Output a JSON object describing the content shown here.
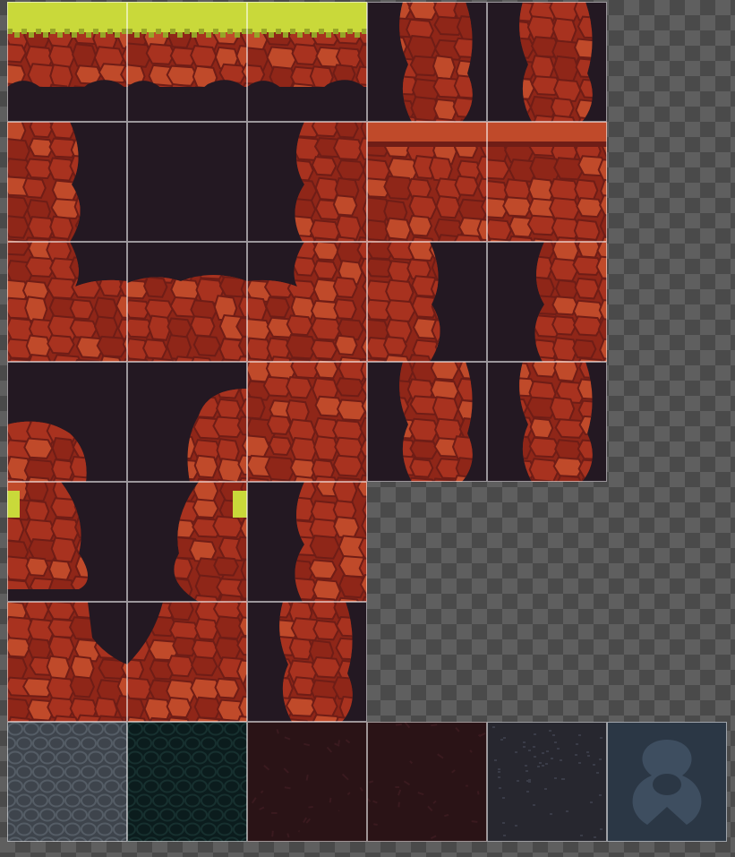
{
  "tileset": {
    "colors": {
      "dark": "#231822",
      "rock": "#8f2618",
      "rockMid": "#a8321f",
      "rockLight": "#c04a2a",
      "rockShadow": "#6f1d16",
      "moss": "#c9d93a",
      "mossDark": "#97a528",
      "slate": "#3e444c",
      "slateLight": "#555d66",
      "teal": "#0b1c1d",
      "tealLight": "#17302f",
      "wine": "#2a1316",
      "wineLight": "#3a1a1f",
      "navy": "#27272f",
      "navyLight": "#3a3c48",
      "steel": "#2b3745",
      "steelLight": "#3e4e60"
    },
    "tiles": [
      {
        "id": "r0c0",
        "name": "tile-ground-grass-top-left",
        "kind": "grass-top"
      },
      {
        "id": "r0c1",
        "name": "tile-ground-grass-top-mid",
        "kind": "grass-top"
      },
      {
        "id": "r0c2",
        "name": "tile-ground-grass-top-right",
        "kind": "grass-top"
      },
      {
        "id": "r0c3",
        "name": "tile-rock-pillar-dark-left",
        "kind": "pillar"
      },
      {
        "id": "r0c4",
        "name": "tile-rock-pillar-dark-right",
        "kind": "pillar"
      },
      {
        "id": "r1c0",
        "name": "tile-cave-wall-left",
        "kind": "wall-left"
      },
      {
        "id": "r1c1",
        "name": "tile-cave-interior",
        "kind": "dark"
      },
      {
        "id": "r1c2",
        "name": "tile-cave-wall-right",
        "kind": "wall-right"
      },
      {
        "id": "r1c3",
        "name": "tile-rock-ledge-top-a",
        "kind": "ledge-top"
      },
      {
        "id": "r1c4",
        "name": "tile-rock-ledge-top-b",
        "kind": "ledge-top"
      },
      {
        "id": "r2c0",
        "name": "tile-cave-floor-left",
        "kind": "floor-left"
      },
      {
        "id": "r2c1",
        "name": "tile-cave-floor-mid",
        "kind": "floor-mid"
      },
      {
        "id": "r2c2",
        "name": "tile-cave-floor-right",
        "kind": "floor-right"
      },
      {
        "id": "r2c3",
        "name": "tile-rock-corner-inner-left",
        "kind": "wall-left"
      },
      {
        "id": "r2c4",
        "name": "tile-rock-corner-inner-right",
        "kind": "wall-right"
      },
      {
        "id": "r3c0",
        "name": "tile-cave-dark-bottom-left-rocks",
        "kind": "dark-corner-bl"
      },
      {
        "id": "r3c1",
        "name": "tile-cave-dark-bottom-right-rocks",
        "kind": "dark-corner-br"
      },
      {
        "id": "r3c2",
        "name": "tile-rock-solid",
        "kind": "solid"
      },
      {
        "id": "r3c3",
        "name": "tile-rock-column-left",
        "kind": "pillar"
      },
      {
        "id": "r3c4",
        "name": "tile-rock-column-right",
        "kind": "pillar"
      },
      {
        "id": "r4c0",
        "name": "tile-rock-moss-left-edge",
        "kind": "moss-left"
      },
      {
        "id": "r4c1",
        "name": "tile-rock-moss-right-edge",
        "kind": "moss-right"
      },
      {
        "id": "r4c2",
        "name": "tile-rock-wall-right-solid",
        "kind": "wall-right"
      },
      {
        "id": "r5c0",
        "name": "tile-cave-arch-left",
        "kind": "arch-left"
      },
      {
        "id": "r5c1",
        "name": "tile-cave-arch-right",
        "kind": "arch-right"
      },
      {
        "id": "r5c2",
        "name": "tile-rock-column-single",
        "kind": "pillar"
      },
      {
        "id": "r6c0",
        "name": "tile-bg-slate-cobble",
        "kind": "bg-slate"
      },
      {
        "id": "r6c1",
        "name": "tile-bg-teal-cobble",
        "kind": "bg-teal"
      },
      {
        "id": "r6c2",
        "name": "tile-bg-wine-cracks",
        "kind": "bg-wine"
      },
      {
        "id": "r6c3",
        "name": "tile-bg-wine-dark",
        "kind": "bg-wine"
      },
      {
        "id": "r6c4",
        "name": "tile-bg-navy-speckle",
        "kind": "bg-navy"
      },
      {
        "id": "r6c5",
        "name": "tile-bg-steel-pattern",
        "kind": "bg-steel"
      }
    ]
  }
}
